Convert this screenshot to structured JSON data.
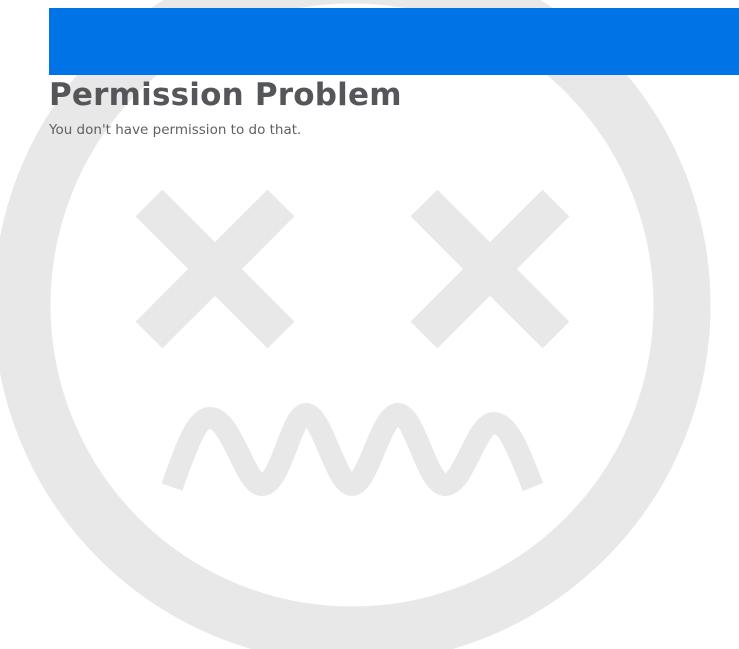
{
  "colors": {
    "header_bar": "#0073e6",
    "illustration": "#e8e8e8",
    "title_text": "#55565a",
    "message_text": "#5f6065",
    "background": "#ffffff"
  },
  "header": {
    "bar_label": ""
  },
  "error": {
    "title": "Permission Problem",
    "message": "You don't have permission to do that."
  },
  "illustration": {
    "icon": "dizzy-face-icon"
  }
}
